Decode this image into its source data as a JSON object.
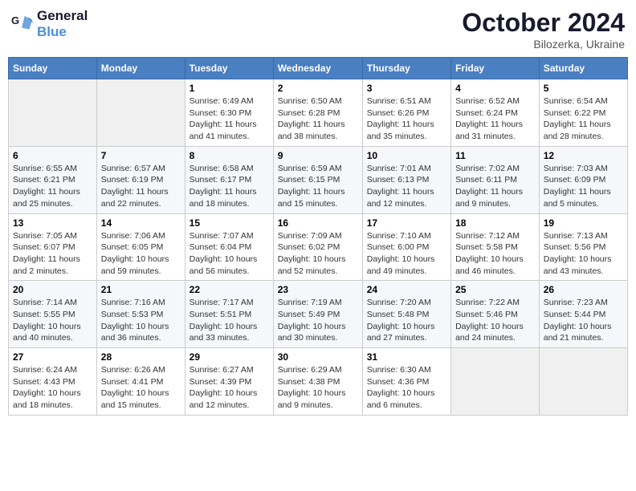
{
  "header": {
    "logo_line1": "General",
    "logo_line2": "Blue",
    "month": "October 2024",
    "location": "Bilozerka, Ukraine"
  },
  "days_of_week": [
    "Sunday",
    "Monday",
    "Tuesday",
    "Wednesday",
    "Thursday",
    "Friday",
    "Saturday"
  ],
  "weeks": [
    [
      {
        "day": null
      },
      {
        "day": null
      },
      {
        "day": "1",
        "sunrise": "6:49 AM",
        "sunset": "6:30 PM",
        "daylight": "11 hours and 41 minutes."
      },
      {
        "day": "2",
        "sunrise": "6:50 AM",
        "sunset": "6:28 PM",
        "daylight": "11 hours and 38 minutes."
      },
      {
        "day": "3",
        "sunrise": "6:51 AM",
        "sunset": "6:26 PM",
        "daylight": "11 hours and 35 minutes."
      },
      {
        "day": "4",
        "sunrise": "6:52 AM",
        "sunset": "6:24 PM",
        "daylight": "11 hours and 31 minutes."
      },
      {
        "day": "5",
        "sunrise": "6:54 AM",
        "sunset": "6:22 PM",
        "daylight": "11 hours and 28 minutes."
      }
    ],
    [
      {
        "day": "6",
        "sunrise": "6:55 AM",
        "sunset": "6:21 PM",
        "daylight": "11 hours and 25 minutes."
      },
      {
        "day": "7",
        "sunrise": "6:57 AM",
        "sunset": "6:19 PM",
        "daylight": "11 hours and 22 minutes."
      },
      {
        "day": "8",
        "sunrise": "6:58 AM",
        "sunset": "6:17 PM",
        "daylight": "11 hours and 18 minutes."
      },
      {
        "day": "9",
        "sunrise": "6:59 AM",
        "sunset": "6:15 PM",
        "daylight": "11 hours and 15 minutes."
      },
      {
        "day": "10",
        "sunrise": "7:01 AM",
        "sunset": "6:13 PM",
        "daylight": "11 hours and 12 minutes."
      },
      {
        "day": "11",
        "sunrise": "7:02 AM",
        "sunset": "6:11 PM",
        "daylight": "11 hours and 9 minutes."
      },
      {
        "day": "12",
        "sunrise": "7:03 AM",
        "sunset": "6:09 PM",
        "daylight": "11 hours and 5 minutes."
      }
    ],
    [
      {
        "day": "13",
        "sunrise": "7:05 AM",
        "sunset": "6:07 PM",
        "daylight": "11 hours and 2 minutes."
      },
      {
        "day": "14",
        "sunrise": "7:06 AM",
        "sunset": "6:05 PM",
        "daylight": "10 hours and 59 minutes."
      },
      {
        "day": "15",
        "sunrise": "7:07 AM",
        "sunset": "6:04 PM",
        "daylight": "10 hours and 56 minutes."
      },
      {
        "day": "16",
        "sunrise": "7:09 AM",
        "sunset": "6:02 PM",
        "daylight": "10 hours and 52 minutes."
      },
      {
        "day": "17",
        "sunrise": "7:10 AM",
        "sunset": "6:00 PM",
        "daylight": "10 hours and 49 minutes."
      },
      {
        "day": "18",
        "sunrise": "7:12 AM",
        "sunset": "5:58 PM",
        "daylight": "10 hours and 46 minutes."
      },
      {
        "day": "19",
        "sunrise": "7:13 AM",
        "sunset": "5:56 PM",
        "daylight": "10 hours and 43 minutes."
      }
    ],
    [
      {
        "day": "20",
        "sunrise": "7:14 AM",
        "sunset": "5:55 PM",
        "daylight": "10 hours and 40 minutes."
      },
      {
        "day": "21",
        "sunrise": "7:16 AM",
        "sunset": "5:53 PM",
        "daylight": "10 hours and 36 minutes."
      },
      {
        "day": "22",
        "sunrise": "7:17 AM",
        "sunset": "5:51 PM",
        "daylight": "10 hours and 33 minutes."
      },
      {
        "day": "23",
        "sunrise": "7:19 AM",
        "sunset": "5:49 PM",
        "daylight": "10 hours and 30 minutes."
      },
      {
        "day": "24",
        "sunrise": "7:20 AM",
        "sunset": "5:48 PM",
        "daylight": "10 hours and 27 minutes."
      },
      {
        "day": "25",
        "sunrise": "7:22 AM",
        "sunset": "5:46 PM",
        "daylight": "10 hours and 24 minutes."
      },
      {
        "day": "26",
        "sunrise": "7:23 AM",
        "sunset": "5:44 PM",
        "daylight": "10 hours and 21 minutes."
      }
    ],
    [
      {
        "day": "27",
        "sunrise": "6:24 AM",
        "sunset": "4:43 PM",
        "daylight": "10 hours and 18 minutes."
      },
      {
        "day": "28",
        "sunrise": "6:26 AM",
        "sunset": "4:41 PM",
        "daylight": "10 hours and 15 minutes."
      },
      {
        "day": "29",
        "sunrise": "6:27 AM",
        "sunset": "4:39 PM",
        "daylight": "10 hours and 12 minutes."
      },
      {
        "day": "30",
        "sunrise": "6:29 AM",
        "sunset": "4:38 PM",
        "daylight": "10 hours and 9 minutes."
      },
      {
        "day": "31",
        "sunrise": "6:30 AM",
        "sunset": "4:36 PM",
        "daylight": "10 hours and 6 minutes."
      },
      {
        "day": null
      },
      {
        "day": null
      }
    ]
  ],
  "labels": {
    "sunrise_prefix": "Sunrise: ",
    "sunset_prefix": "Sunset: ",
    "daylight_prefix": "Daylight: "
  }
}
